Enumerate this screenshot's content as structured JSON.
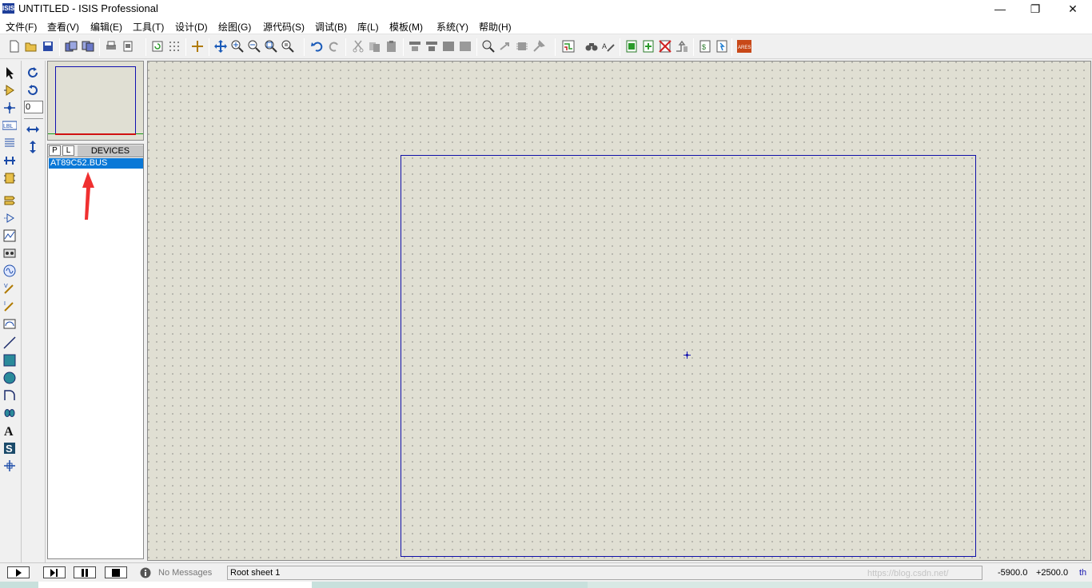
{
  "window": {
    "app_icon_label": "ISIS",
    "title": "UNTITLED - ISIS Professional",
    "minimize": "—",
    "maximize": "❐",
    "close": "✕"
  },
  "menu": [
    "文件(F)",
    "查看(V)",
    "编辑(E)",
    "工具(T)",
    "设计(D)",
    "绘图(G)",
    "源代码(S)",
    "调试(B)",
    "库(L)",
    "模板(M)",
    "系统(Y)",
    "帮助(H)"
  ],
  "toolbar": {
    "icons": [
      "new-file-icon",
      "open-file-icon",
      "save-icon",
      "import-icon",
      "export-icon",
      "print-icon",
      "print-area-icon",
      "refresh-icon",
      "grid-icon",
      "origin-icon",
      "pan-icon",
      "zoom-in-icon",
      "zoom-out-icon",
      "zoom-all-icon",
      "zoom-area-icon",
      "undo-icon",
      "redo-icon",
      "cut-icon",
      "copy-icon",
      "paste-icon",
      "block-copy-icon",
      "block-move-icon",
      "block-rotate-icon",
      "block-delete-icon",
      "pick-device-icon",
      "make-device-icon",
      "packaging-icon",
      "decompose-icon",
      "wire-autorouter-icon",
      "search-tag-icon",
      "property-tool-icon",
      "new-sheet-icon",
      "add-sheet-icon",
      "delete-sheet-icon",
      "goto-sheet-icon",
      "bill-of-materials-icon",
      "electrical-rule-check-icon",
      "netlist-to-ares-icon"
    ]
  },
  "rotation": {
    "angle_value": "0"
  },
  "device_panel": {
    "p_button": "P",
    "l_button": "L",
    "title": "DEVICES",
    "items": [
      "AT89C52.BUS"
    ]
  },
  "status": {
    "messages": "No Messages",
    "sheet": "Root sheet 1",
    "coord_x": "-5900.0",
    "coord_y": "+2500.0",
    "unit": "th",
    "watermark": "https://blog.csdn.net/"
  }
}
